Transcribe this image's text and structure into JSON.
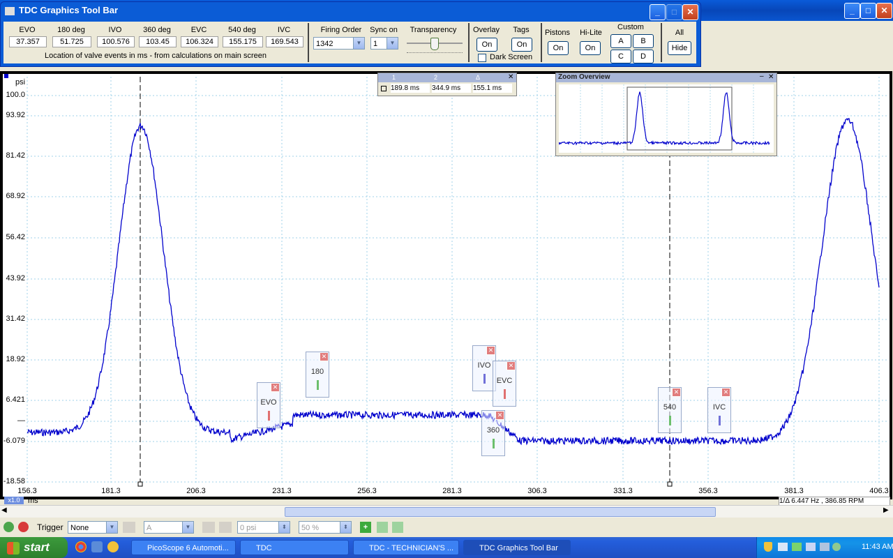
{
  "toolbar": {
    "title": "TDC Graphics Tool Bar",
    "events": [
      {
        "label": "EVO",
        "value": "37.357"
      },
      {
        "label": "180 deg",
        "value": "51.725"
      },
      {
        "label": "IVO",
        "value": "100.576"
      },
      {
        "label": "360 deg",
        "value": "103.45"
      },
      {
        "label": "EVC",
        "value": "106.324"
      },
      {
        "label": "540 deg",
        "value": "155.175"
      },
      {
        "label": "IVC",
        "value": "169.543"
      }
    ],
    "events_caption": "Location of valve events in ms - from calculations on main screen",
    "firing_order_label": "Firing Order",
    "firing_order_value": "1342",
    "sync_on_label": "Sync on",
    "sync_on_value": "1",
    "transparency_label": "Transparency",
    "overlay_label": "Overlay",
    "overlay_btn": "On",
    "tags_label": "Tags",
    "tags_btn": "On",
    "dark_screen_label": "Dark Screen",
    "pistons_label": "Pistons",
    "pistons_btn": "On",
    "hilite_label": "Hi-Lite",
    "hilite_btn": "On",
    "custom_label": "Custom",
    "custom_a": "A",
    "custom_b": "B",
    "custom_c": "C",
    "custom_d": "D",
    "all_label": "All",
    "all_btn": "Hide"
  },
  "window_buttons": {
    "min": "_",
    "max": "□",
    "close": "✕"
  },
  "ruler": {
    "h1": "1",
    "h2": "2",
    "h3": "Δ",
    "v1": "189.8 ms",
    "v2": "344.9 ms",
    "v3": "155.1 ms"
  },
  "zoom_overview": {
    "title": "Zoom Overview"
  },
  "plot": {
    "y_unit": "psi",
    "y_ticks": [
      "100.0",
      "93.92",
      "81.42",
      "68.92",
      "56.42",
      "43.92",
      "31.42",
      "18.92",
      "6.421",
      "—",
      "-6.079",
      "-18.58"
    ],
    "x_ticks": [
      "156.3",
      "181.3",
      "206.3",
      "231.3",
      "256.3",
      "281.3",
      "306.3",
      "331.3",
      "356.3",
      "381.3",
      "406.3"
    ],
    "x_unit": "ms",
    "zoom_badge": "x1.0",
    "freq_readout": "1/Δ  6.447 Hz , 386.85 RPM"
  },
  "tags": [
    {
      "id": "evo",
      "label": "EVO",
      "color": "#E07070"
    },
    {
      "id": "180",
      "label": "180",
      "color": "#6CBF6C"
    },
    {
      "id": "ivo",
      "label": "IVO",
      "color": "#7070D8"
    },
    {
      "id": "evc",
      "label": "EVC",
      "color": "#E07070"
    },
    {
      "id": "360",
      "label": "360",
      "color": "#6CBF6C"
    },
    {
      "id": "540",
      "label": "540",
      "color": "#6CBF6C"
    },
    {
      "id": "ivc",
      "label": "IVC",
      "color": "#7070D8"
    }
  ],
  "bottom": {
    "trigger_label": "Trigger",
    "trigger_mode": "None",
    "channel": "A",
    "threshold": "0 psi",
    "pretrigger": "50 %"
  },
  "taskbar": {
    "start": "start",
    "tasks": [
      "PicoScope 6 Automoti...",
      "TDC",
      "TDC - TECHNICIAN'S ...",
      "TDC Graphics Tool Bar"
    ],
    "clock": "11:43 AM"
  },
  "colors": {
    "trace": "#0000CC",
    "xp_blue": "#0B5CD6",
    "taskbar": "#245EDC",
    "start_green": "#3C9A3C"
  }
}
